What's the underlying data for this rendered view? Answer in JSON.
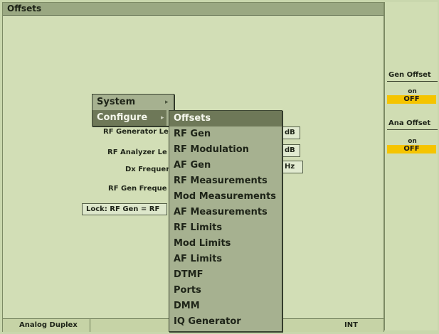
{
  "window": {
    "title": "Offsets"
  },
  "status": {
    "mode": "Analog Duplex",
    "ref": "INT"
  },
  "softkeys": [
    {
      "title": "Gen Offset",
      "on_label": "on",
      "off_label": "OFF"
    },
    {
      "title": "Ana Offset",
      "on_label": "on",
      "off_label": "OFF"
    }
  ],
  "fields": {
    "rf_gen_level": {
      "label": "RF Generator Le",
      "unit": "dB"
    },
    "rf_analyzer_level": {
      "label": "RF Analyzer Le",
      "unit": "dB"
    },
    "dx_freq": {
      "label": "Dx Frequen",
      "unit": "Hz"
    },
    "rf_gen_freq": {
      "label": "RF Gen Freque"
    },
    "lock": "Lock: RF Gen = RF"
  },
  "menu": {
    "items": [
      {
        "label": "System",
        "arrow": "▸"
      },
      {
        "label": "Configure",
        "arrow": "▸"
      }
    ]
  },
  "submenu": {
    "items": [
      "Offsets",
      "RF Gen",
      "RF Modulation",
      "AF Gen",
      "RF Measurements",
      "Mod Measurements",
      "AF Measurements",
      "RF Limits",
      "Mod Limits",
      "AF Limits",
      "DTMF",
      "Ports",
      "DMM",
      "IQ Generator"
    ]
  },
  "colors": {
    "background": "#d2deb6",
    "menu": "#a6b190",
    "menu_selected": "#6e7858",
    "off_indicator": "#f5c400"
  }
}
